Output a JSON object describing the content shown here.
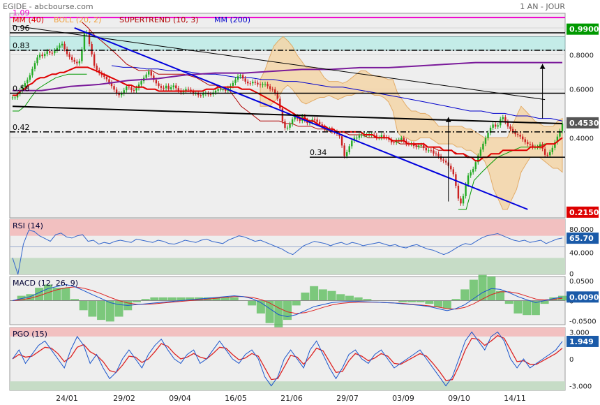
{
  "header": {
    "left": "EGIDE - abcbourse.com",
    "right": "1 AN - JOUR"
  },
  "chart_data": {
    "type": "line",
    "main": {
      "yscale": "log",
      "ticks": [
        {
          "v": 1.0,
          "label": "1.000"
        },
        {
          "v": 0.8,
          "label": "0.8000"
        },
        {
          "v": 0.6,
          "label": "0.6000"
        },
        {
          "v": 0.4,
          "label": "0.4000"
        }
      ],
      "legend": [
        {
          "label": "MM (40)",
          "color": "#dd0000"
        },
        {
          "label": "BOLL (20, 2)",
          "color": "#f0a040"
        },
        {
          "label": "SUPERTREND (10, 3)",
          "color": "#b00000"
        },
        {
          "label": "MM (200)",
          "color": "#0000cc"
        }
      ],
      "levels": [
        {
          "v": 1.09,
          "label": "1.09",
          "color": "#ee00cc"
        },
        {
          "v": 0.96,
          "label": "0.96",
          "color": "#000000"
        },
        {
          "v": 0.83,
          "label": "0.83",
          "color": "#000000",
          "dashed": true
        },
        {
          "v": 0.58,
          "label": "0.58",
          "color": "#000000"
        },
        {
          "v": 0.42,
          "label": "0.42",
          "color": "#000000",
          "dashed": true
        },
        {
          "v": 0.34,
          "label": "0.34",
          "color": "#000000"
        }
      ],
      "zone": [
        0.83,
        0.93
      ],
      "badges": [
        {
          "v": 0.99,
          "label": "0.9900",
          "color": "#009900"
        },
        {
          "v": 0.453,
          "label": "0.4530",
          "color": "#555555"
        },
        {
          "v": 0.215,
          "label": "0.2150",
          "color": "#dd0000"
        }
      ],
      "price_close": [
        0.56,
        0.56,
        0.58,
        0.6,
        0.62,
        0.64,
        0.66,
        0.7,
        0.74,
        0.78,
        0.8,
        0.79,
        0.81,
        0.83,
        0.8,
        0.82,
        0.84,
        0.86,
        0.88,
        0.84,
        0.8,
        0.78,
        0.76,
        0.75,
        0.74,
        0.78,
        0.94,
        0.98,
        0.88,
        0.8,
        0.72,
        0.7,
        0.68,
        0.67,
        0.66,
        0.64,
        0.62,
        0.6,
        0.58,
        0.57,
        0.58,
        0.6,
        0.62,
        0.6,
        0.59,
        0.6,
        0.62,
        0.64,
        0.66,
        0.68,
        0.7,
        0.66,
        0.64,
        0.62,
        0.61,
        0.6,
        0.62,
        0.6,
        0.61,
        0.62,
        0.6,
        0.59,
        0.58,
        0.6,
        0.6,
        0.59,
        0.58,
        0.58,
        0.57,
        0.57,
        0.58,
        0.58,
        0.57,
        0.58,
        0.59,
        0.6,
        0.6,
        0.6,
        0.59,
        0.61,
        0.62,
        0.64,
        0.66,
        0.68,
        0.66,
        0.64,
        0.63,
        0.63,
        0.64,
        0.63,
        0.62,
        0.62,
        0.63,
        0.62,
        0.6,
        0.6,
        0.58,
        0.55,
        0.5,
        0.44,
        0.43,
        0.44,
        0.46,
        0.48,
        0.47,
        0.46,
        0.48,
        0.46,
        0.45,
        0.46,
        0.47,
        0.46,
        0.45,
        0.44,
        0.43,
        0.43,
        0.43,
        0.42,
        0.42,
        0.41,
        0.4,
        0.34,
        0.35,
        0.37,
        0.39,
        0.4,
        0.4,
        0.41,
        0.41,
        0.41,
        0.41,
        0.41,
        0.41,
        0.4,
        0.4,
        0.41,
        0.4,
        0.4,
        0.39,
        0.38,
        0.39,
        0.39,
        0.4,
        0.39,
        0.38,
        0.38,
        0.38,
        0.37,
        0.37,
        0.38,
        0.37,
        0.36,
        0.36,
        0.36,
        0.35,
        0.35,
        0.34,
        0.33,
        0.33,
        0.32,
        0.31,
        0.3,
        0.27,
        0.24,
        0.23,
        0.25,
        0.28,
        0.3,
        0.3,
        0.32,
        0.34,
        0.36,
        0.38,
        0.4,
        0.42,
        0.44,
        0.45,
        0.43,
        0.46,
        0.48,
        0.46,
        0.44,
        0.43,
        0.42,
        0.41,
        0.41,
        0.4,
        0.39,
        0.38,
        0.38,
        0.37,
        0.37,
        0.37,
        0.38,
        0.36,
        0.34,
        0.35,
        0.36,
        0.38,
        0.4,
        0.42,
        0.45
      ],
      "mm40": [
        0.57,
        0.57,
        0.59,
        0.6,
        0.62,
        0.63,
        0.65,
        0.66,
        0.66,
        0.67,
        0.68,
        0.68,
        0.69,
        0.69,
        0.7,
        0.71,
        0.72,
        0.72,
        0.72,
        0.72,
        0.71,
        0.7,
        0.69,
        0.68,
        0.67,
        0.66,
        0.65,
        0.64,
        0.63,
        0.62,
        0.62,
        0.61,
        0.61,
        0.61,
        0.6,
        0.6,
        0.6,
        0.59,
        0.59,
        0.59,
        0.59,
        0.59,
        0.59,
        0.59,
        0.59,
        0.59,
        0.59,
        0.59,
        0.59,
        0.6,
        0.6,
        0.6,
        0.61,
        0.61,
        0.61,
        0.61,
        0.61,
        0.61,
        0.6,
        0.6,
        0.6,
        0.59,
        0.58,
        0.57,
        0.56,
        0.55,
        0.54,
        0.53,
        0.52,
        0.51,
        0.5,
        0.49,
        0.48,
        0.47,
        0.47,
        0.46,
        0.46,
        0.45,
        0.44,
        0.44,
        0.43,
        0.43,
        0.42,
        0.42,
        0.42,
        0.42,
        0.42,
        0.42,
        0.42,
        0.41,
        0.41,
        0.41,
        0.4,
        0.4,
        0.4,
        0.4,
        0.39,
        0.39,
        0.39,
        0.39,
        0.38,
        0.38,
        0.38,
        0.38,
        0.38,
        0.37,
        0.37,
        0.37,
        0.37,
        0.36,
        0.36,
        0.36,
        0.35,
        0.35,
        0.35,
        0.34,
        0.34,
        0.33,
        0.33,
        0.34,
        0.34,
        0.35,
        0.35,
        0.35,
        0.36,
        0.36,
        0.36,
        0.36,
        0.36,
        0.36,
        0.36,
        0.37,
        0.37,
        0.37,
        0.37,
        0.38,
        0.38,
        0.38,
        0.39,
        0.4
      ],
      "mm200": [
        0.73,
        0.72,
        0.72,
        0.71,
        0.71,
        0.7,
        0.7,
        0.69,
        0.68,
        0.68,
        0.67,
        0.66,
        0.66,
        0.65,
        0.65,
        0.64,
        0.64,
        0.63,
        0.62,
        0.61,
        0.61,
        0.6,
        0.59,
        0.58,
        0.57,
        0.56,
        0.55,
        0.54,
        0.53,
        0.52,
        0.51,
        0.5,
        0.5,
        0.49,
        0.49,
        0.48,
        0.48,
        0.47,
        0.47,
        0.46
      ],
      "boll_up": [
        0.65,
        0.7,
        0.78,
        0.86,
        0.9,
        0.93,
        0.9,
        0.86,
        0.8,
        0.76,
        0.72,
        0.72,
        0.72,
        0.7,
        0.66,
        0.64,
        0.64,
        0.64,
        0.63,
        0.64,
        0.66,
        0.68,
        0.7,
        0.7,
        0.68,
        0.67,
        0.67,
        0.66,
        0.65,
        0.65,
        0.58,
        0.55,
        0.52,
        0.5,
        0.5,
        0.49,
        0.49,
        0.48,
        0.46,
        0.44,
        0.44,
        0.44,
        0.44,
        0.44,
        0.44,
        0.43,
        0.43,
        0.42,
        0.41,
        0.4,
        0.4,
        0.4,
        0.4,
        0.4,
        0.4,
        0.44,
        0.48,
        0.52,
        0.5,
        0.48,
        0.46,
        0.45,
        0.44,
        0.44,
        0.44,
        0.46,
        0.47
      ],
      "boll_low": [
        0.52,
        0.52,
        0.52,
        0.54,
        0.56,
        0.6,
        0.62,
        0.6,
        0.57,
        0.54,
        0.53,
        0.54,
        0.55,
        0.56,
        0.56,
        0.57,
        0.56,
        0.55,
        0.56,
        0.57,
        0.57,
        0.58,
        0.58,
        0.59,
        0.58,
        0.57,
        0.57,
        0.56,
        0.54,
        0.5,
        0.42,
        0.4,
        0.4,
        0.39,
        0.39,
        0.4,
        0.4,
        0.4,
        0.39,
        0.38,
        0.38,
        0.38,
        0.38,
        0.37,
        0.37,
        0.36,
        0.36,
        0.35,
        0.34,
        0.33,
        0.3,
        0.26,
        0.24,
        0.22,
        0.22,
        0.24,
        0.26,
        0.3,
        0.32,
        0.34,
        0.34,
        0.34,
        0.33,
        0.32,
        0.31,
        0.31,
        0.3
      ],
      "supertrend": [
        [
          0.5,
          0.5,
          0.52,
          0.56,
          0.6,
          0.62,
          0.64,
          0.66,
          0.67,
          0.68,
          0.68,
          0.68,
          0.68
        ],
        [
          1.05,
          1.0,
          0.94,
          0.9,
          0.86,
          0.82,
          0.78,
          0.74,
          0.72,
          0.7,
          0.7,
          0.7,
          0.68,
          0.68,
          0.68,
          0.68,
          0.68,
          0.67,
          0.66,
          0.64,
          0.62,
          0.62,
          0.6,
          0.6,
          0.56,
          0.52,
          0.5,
          0.48,
          0.46,
          0.46,
          0.46,
          0.46,
          0.45,
          0.45,
          0.44,
          0.44,
          0.44,
          0.43,
          0.43,
          0.42,
          0.42,
          0.42,
          0.41,
          0.41,
          0.41,
          0.4,
          0.4,
          0.4,
          0.4,
          0.39,
          0.38,
          0.38,
          0.38,
          0.37,
          0.37,
          0.37,
          0.36,
          0.36,
          0.36,
          0.35,
          0.35,
          0.34,
          0.34,
          0.34
        ],
        [
          0.22,
          0.22,
          0.28,
          0.3,
          0.32,
          0.34,
          0.35,
          0.36,
          0.37,
          0.37,
          0.37,
          0.38,
          0.38
        ]
      ],
      "trendlines": [
        {
          "from": [
            0,
            1.02
          ],
          "to": [
            215,
            0.55
          ],
          "color": "#000000",
          "width": 1
        },
        {
          "from": [
            25,
            1.0
          ],
          "to": [
            208,
            0.22
          ],
          "color": "#0000dd",
          "width": 2
        },
        {
          "from": [
            0,
            0.52
          ],
          "to": [
            222,
            0.45
          ],
          "color": "#000000",
          "width": 2
        }
      ],
      "arrows": [
        {
          "x": 176,
          "from": 0.235,
          "to": 0.475
        },
        {
          "x": 214,
          "from": 0.47,
          "to": 0.74
        }
      ]
    },
    "rsi": {
      "label": "RSI (14)",
      "ticks": [
        "80.000",
        "40.000",
        "0"
      ],
      "value": "65.70",
      "lines": [
        30,
        70
      ],
      "ylim": [
        0,
        100
      ],
      "values": [
        30,
        0,
        55,
        80,
        78,
        70,
        65,
        60,
        72,
        75,
        68,
        66,
        70,
        72,
        60,
        62,
        55,
        58,
        56,
        60,
        62,
        60,
        58,
        64,
        62,
        60,
        58,
        62,
        60,
        56,
        55,
        58,
        62,
        60,
        58,
        62,
        64,
        60,
        58,
        56,
        62,
        66,
        70,
        68,
        64,
        60,
        62,
        58,
        54,
        50,
        46,
        40,
        36,
        44,
        52,
        56,
        60,
        58,
        56,
        52,
        56,
        58,
        54,
        58,
        56,
        52,
        54,
        56,
        58,
        55,
        52,
        54,
        50,
        48,
        52,
        54,
        50,
        46,
        44,
        40,
        36,
        40,
        46,
        52,
        56,
        54,
        60,
        66,
        70,
        72,
        74,
        70,
        66,
        62,
        60,
        62,
        58,
        60,
        62,
        56,
        60,
        64,
        66
      ],
      "color": "#3366cc"
    },
    "macd": {
      "label": "MACD (12, 26, 9)",
      "ticks": [
        "0.0500",
        "0",
        "-0.0500"
      ],
      "value": "0.0090",
      "ylim": [
        -0.06,
        0.06
      ],
      "macd": [
        0,
        0.005,
        0.01,
        0.02,
        0.03,
        0.035,
        0.04,
        0.035,
        0.025,
        0.015,
        0.005,
        -0.005,
        -0.01,
        -0.012,
        -0.01,
        -0.008,
        -0.006,
        -0.004,
        -0.002,
        0,
        0.002,
        0.004,
        0.006,
        0.008,
        0.01,
        0.012,
        0.01,
        0.005,
        -0.005,
        -0.02,
        -0.035,
        -0.04,
        -0.035,
        -0.025,
        -0.015,
        -0.01,
        -0.005,
        -0.003,
        -0.002,
        -0.002,
        -0.003,
        -0.004,
        -0.005,
        -0.006,
        -0.008,
        -0.01,
        -0.012,
        -0.015,
        -0.02,
        -0.025,
        -0.02,
        -0.01,
        0.005,
        0.02,
        0.03,
        0.028,
        0.02,
        0.01,
        0.002,
        -0.005,
        0,
        0.005,
        0.009
      ],
      "signal": [
        0,
        0.002,
        0.006,
        0.012,
        0.02,
        0.027,
        0.032,
        0.034,
        0.031,
        0.025,
        0.017,
        0.008,
        0,
        -0.006,
        -0.009,
        -0.009,
        -0.008,
        -0.006,
        -0.004,
        -0.002,
        0,
        0.002,
        0.004,
        0.006,
        0.008,
        0.01,
        0.01,
        0.008,
        0.003,
        -0.006,
        -0.018,
        -0.028,
        -0.032,
        -0.03,
        -0.024,
        -0.017,
        -0.011,
        -0.007,
        -0.005,
        -0.004,
        -0.004,
        -0.004,
        -0.005,
        -0.006,
        -0.007,
        -0.009,
        -0.011,
        -0.013,
        -0.016,
        -0.02,
        -0.021,
        -0.017,
        -0.008,
        0.004,
        0.015,
        0.022,
        0.022,
        0.018,
        0.011,
        0.004,
        0.002,
        0.003,
        0.006
      ]
    },
    "pgo": {
      "label": "PGO (15)",
      "ticks": [
        "3.000",
        "0",
        "-3.000"
      ],
      "value": "1.949",
      "lines": [
        -2.5,
        2.5
      ],
      "ylim": [
        -3.5,
        3.5
      ],
      "pgo": [
        0,
        1,
        -0.5,
        0.5,
        1.5,
        2,
        1,
        0,
        -1,
        1,
        2.5,
        1.5,
        -0.5,
        0.5,
        -1,
        -2.2,
        -1.5,
        0,
        1,
        0,
        -1,
        0.5,
        1.5,
        2.2,
        1,
        0,
        -0.5,
        0.5,
        1,
        -0.5,
        0,
        1,
        2,
        1,
        0,
        -0.5,
        0.5,
        1,
        0,
        -2,
        -3,
        -2,
        0,
        1,
        0,
        -1,
        1,
        2,
        0.5,
        -1,
        -2.2,
        -1,
        0.5,
        1,
        0,
        -0.5,
        0.5,
        1,
        0,
        -1,
        -0.5,
        0,
        0.5,
        1,
        0,
        -1,
        -2,
        -3,
        -2,
        0,
        2,
        3,
        2,
        1,
        2.5,
        3,
        2,
        0,
        -1,
        0,
        -1,
        -0.5,
        0,
        0.5,
        1,
        1.949
      ],
      "sig": [
        0,
        0.5,
        0.2,
        0.3,
        0.8,
        1.3,
        1.2,
        0.6,
        -0.3,
        0.2,
        1.3,
        1.6,
        0.8,
        0.4,
        -0.3,
        -1.3,
        -1.5,
        -0.7,
        0.3,
        0.2,
        -0.4,
        0,
        0.8,
        1.7,
        1.4,
        0.6,
        0,
        0.2,
        0.6,
        0.2,
        0,
        0.6,
        1.3,
        1.2,
        0.5,
        -0.1,
        0.1,
        0.6,
        0.3,
        -1,
        -2.3,
        -2.2,
        -0.9,
        0.4,
        0.2,
        -0.6,
        0.2,
        1.2,
        0.9,
        -0.3,
        -1.5,
        -1.4,
        -0.2,
        0.6,
        0.3,
        -0.2,
        0.1,
        0.6,
        0.3,
        -0.5,
        -0.6,
        -0.2,
        0.2,
        0.6,
        0.3,
        -0.5,
        -1.4,
        -2.4,
        -2.3,
        -0.8,
        1,
        2.3,
        2.2,
        1.5,
        2,
        2.6,
        2.3,
        1,
        -0.3,
        -0.2,
        -0.6,
        -0.6,
        -0.2,
        0.2,
        0.6,
        1.2
      ]
    },
    "x_labels": [
      "24/01",
      "29/02",
      "09/04",
      "16/05",
      "21/06",
      "29/07",
      "03/09",
      "09/10",
      "14/11"
    ]
  }
}
